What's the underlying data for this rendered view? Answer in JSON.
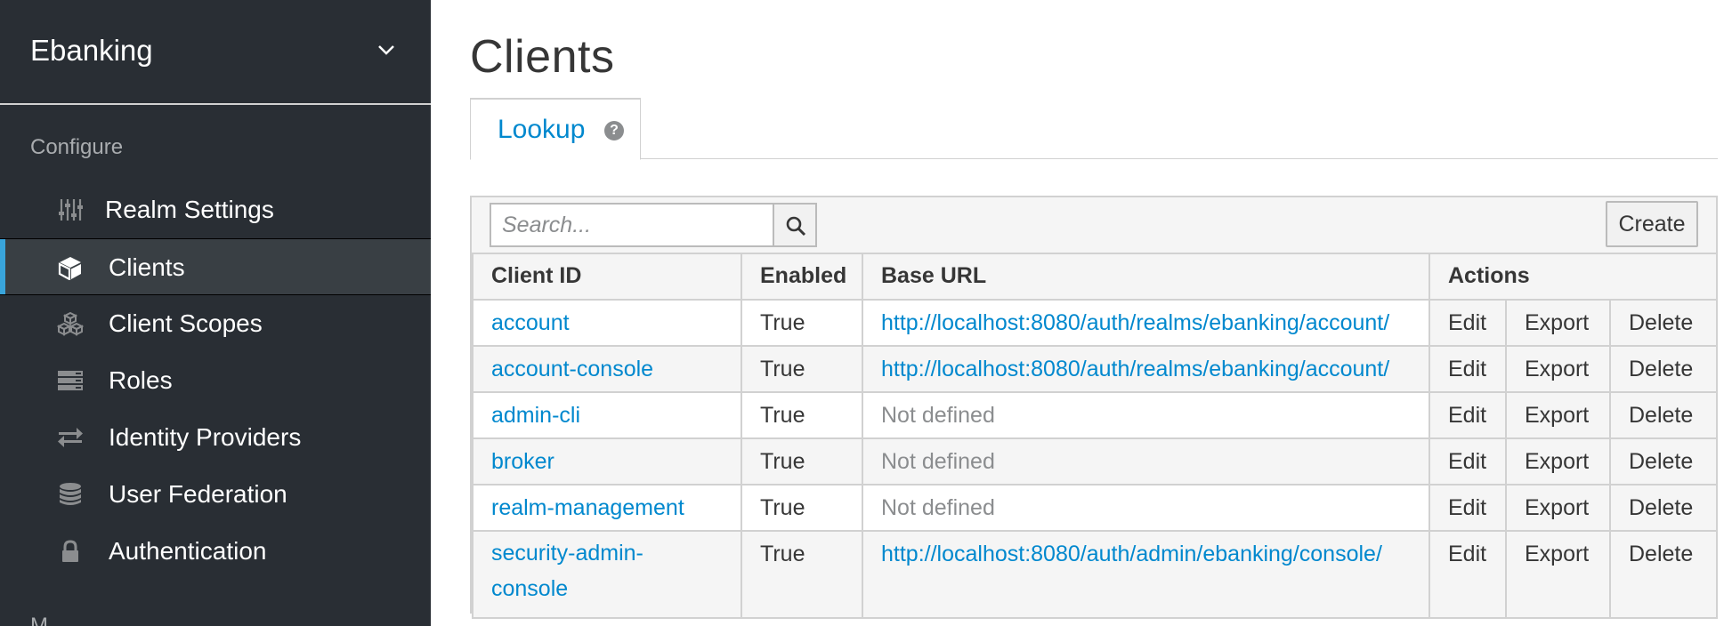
{
  "sidebar": {
    "realm": "Ebanking",
    "section_title": "Configure",
    "items": [
      {
        "label": "Realm Settings",
        "icon": "sliders-icon"
      },
      {
        "label": "Clients",
        "icon": "cube-icon",
        "active": true
      },
      {
        "label": "Client Scopes",
        "icon": "cubes-icon"
      },
      {
        "label": "Roles",
        "icon": "list-icon"
      },
      {
        "label": "Identity Providers",
        "icon": "exchange-icon"
      },
      {
        "label": "User Federation",
        "icon": "database-icon"
      },
      {
        "label": "Authentication",
        "icon": "lock-icon"
      }
    ],
    "next_section": "M"
  },
  "main": {
    "title": "Clients",
    "tabs": [
      {
        "label": "Lookup",
        "help": "?"
      }
    ],
    "search": {
      "placeholder": "Search...",
      "value": ""
    },
    "create_label": "Create",
    "columns": [
      "Client ID",
      "Enabled",
      "Base URL",
      "Actions"
    ],
    "rows": [
      {
        "client_id": "account",
        "enabled": "True",
        "base_url": "http://localhost:8080/auth/realms/ebanking/account/",
        "has_url": true
      },
      {
        "client_id": "account-console",
        "enabled": "True",
        "base_url": "http://localhost:8080/auth/realms/ebanking/account/",
        "has_url": true
      },
      {
        "client_id": "admin-cli",
        "enabled": "True",
        "base_url": "Not defined",
        "has_url": false
      },
      {
        "client_id": "broker",
        "enabled": "True",
        "base_url": "Not defined",
        "has_url": false
      },
      {
        "client_id": "realm-management",
        "enabled": "True",
        "base_url": "Not defined",
        "has_url": false
      },
      {
        "client_id": "security-admin-console",
        "client_id_lines": [
          "security-admin-",
          "console"
        ],
        "enabled": "True",
        "base_url": "http://localhost:8080/auth/admin/ebanking/console/",
        "has_url": true
      }
    ],
    "actions": {
      "edit": "Edit",
      "export": "Export",
      "delete": "Delete"
    }
  },
  "colors": {
    "sidebar_bg": "#292e34",
    "active_item_bg": "#393f44",
    "active_accent": "#39a5dc",
    "link": "#0088ce",
    "muted": "#8b8d8f"
  }
}
